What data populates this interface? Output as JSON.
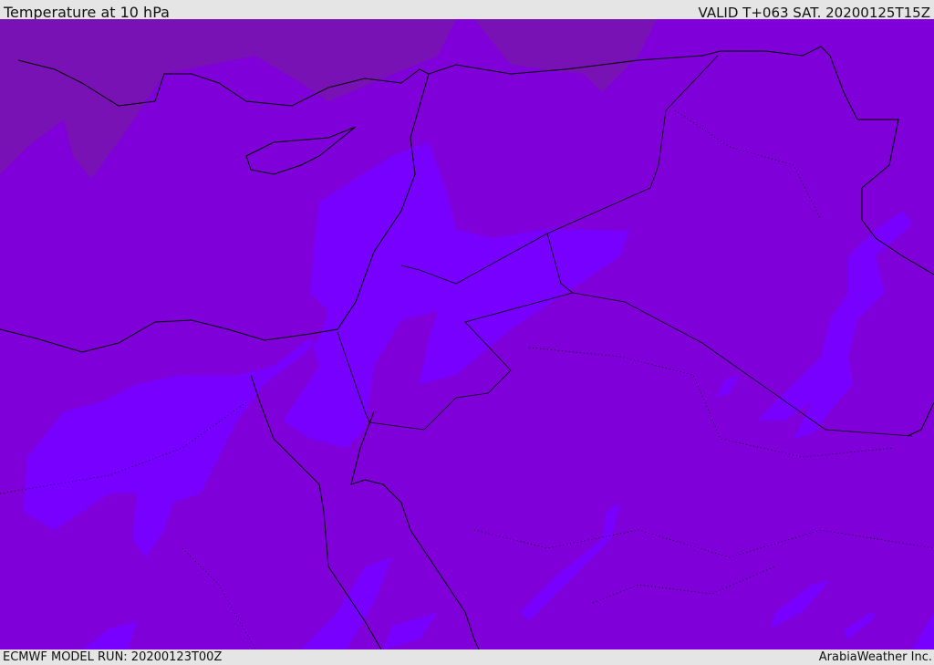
{
  "header": {
    "title": "Temperature at 10 hPa",
    "valid_time": "VALID T+063 SAT. 20200125T15Z"
  },
  "footer": {
    "model_run": "ECMWF MODEL RUN: 20200123T00Z",
    "credit": "ArabiaWeather Inc."
  },
  "colors": {
    "base_field": "#7f00d9",
    "warm_field": "#7700ff",
    "cold_field": "#7812b4",
    "header_bg": "#e5e5e5"
  }
}
